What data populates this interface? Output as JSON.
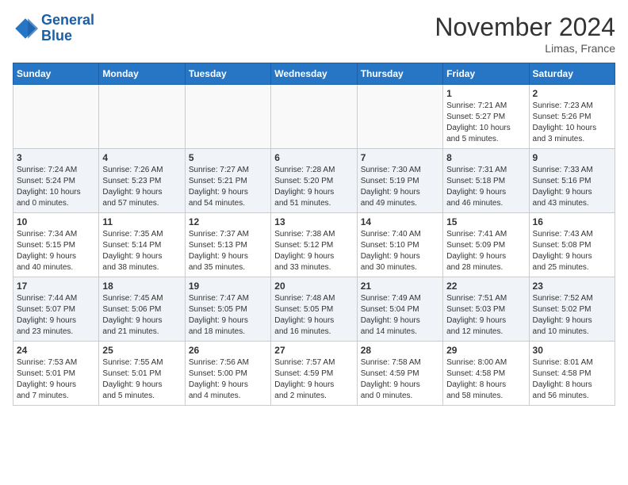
{
  "header": {
    "logo_line1": "General",
    "logo_line2": "Blue",
    "month_title": "November 2024",
    "location": "Limas, France"
  },
  "weekdays": [
    "Sunday",
    "Monday",
    "Tuesday",
    "Wednesday",
    "Thursday",
    "Friday",
    "Saturday"
  ],
  "weeks": [
    [
      {
        "day": "",
        "info": ""
      },
      {
        "day": "",
        "info": ""
      },
      {
        "day": "",
        "info": ""
      },
      {
        "day": "",
        "info": ""
      },
      {
        "day": "",
        "info": ""
      },
      {
        "day": "1",
        "info": "Sunrise: 7:21 AM\nSunset: 5:27 PM\nDaylight: 10 hours\nand 5 minutes."
      },
      {
        "day": "2",
        "info": "Sunrise: 7:23 AM\nSunset: 5:26 PM\nDaylight: 10 hours\nand 3 minutes."
      }
    ],
    [
      {
        "day": "3",
        "info": "Sunrise: 7:24 AM\nSunset: 5:24 PM\nDaylight: 10 hours\nand 0 minutes."
      },
      {
        "day": "4",
        "info": "Sunrise: 7:26 AM\nSunset: 5:23 PM\nDaylight: 9 hours\nand 57 minutes."
      },
      {
        "day": "5",
        "info": "Sunrise: 7:27 AM\nSunset: 5:21 PM\nDaylight: 9 hours\nand 54 minutes."
      },
      {
        "day": "6",
        "info": "Sunrise: 7:28 AM\nSunset: 5:20 PM\nDaylight: 9 hours\nand 51 minutes."
      },
      {
        "day": "7",
        "info": "Sunrise: 7:30 AM\nSunset: 5:19 PM\nDaylight: 9 hours\nand 49 minutes."
      },
      {
        "day": "8",
        "info": "Sunrise: 7:31 AM\nSunset: 5:18 PM\nDaylight: 9 hours\nand 46 minutes."
      },
      {
        "day": "9",
        "info": "Sunrise: 7:33 AM\nSunset: 5:16 PM\nDaylight: 9 hours\nand 43 minutes."
      }
    ],
    [
      {
        "day": "10",
        "info": "Sunrise: 7:34 AM\nSunset: 5:15 PM\nDaylight: 9 hours\nand 40 minutes."
      },
      {
        "day": "11",
        "info": "Sunrise: 7:35 AM\nSunset: 5:14 PM\nDaylight: 9 hours\nand 38 minutes."
      },
      {
        "day": "12",
        "info": "Sunrise: 7:37 AM\nSunset: 5:13 PM\nDaylight: 9 hours\nand 35 minutes."
      },
      {
        "day": "13",
        "info": "Sunrise: 7:38 AM\nSunset: 5:12 PM\nDaylight: 9 hours\nand 33 minutes."
      },
      {
        "day": "14",
        "info": "Sunrise: 7:40 AM\nSunset: 5:10 PM\nDaylight: 9 hours\nand 30 minutes."
      },
      {
        "day": "15",
        "info": "Sunrise: 7:41 AM\nSunset: 5:09 PM\nDaylight: 9 hours\nand 28 minutes."
      },
      {
        "day": "16",
        "info": "Sunrise: 7:43 AM\nSunset: 5:08 PM\nDaylight: 9 hours\nand 25 minutes."
      }
    ],
    [
      {
        "day": "17",
        "info": "Sunrise: 7:44 AM\nSunset: 5:07 PM\nDaylight: 9 hours\nand 23 minutes."
      },
      {
        "day": "18",
        "info": "Sunrise: 7:45 AM\nSunset: 5:06 PM\nDaylight: 9 hours\nand 21 minutes."
      },
      {
        "day": "19",
        "info": "Sunrise: 7:47 AM\nSunset: 5:05 PM\nDaylight: 9 hours\nand 18 minutes."
      },
      {
        "day": "20",
        "info": "Sunrise: 7:48 AM\nSunset: 5:05 PM\nDaylight: 9 hours\nand 16 minutes."
      },
      {
        "day": "21",
        "info": "Sunrise: 7:49 AM\nSunset: 5:04 PM\nDaylight: 9 hours\nand 14 minutes."
      },
      {
        "day": "22",
        "info": "Sunrise: 7:51 AM\nSunset: 5:03 PM\nDaylight: 9 hours\nand 12 minutes."
      },
      {
        "day": "23",
        "info": "Sunrise: 7:52 AM\nSunset: 5:02 PM\nDaylight: 9 hours\nand 10 minutes."
      }
    ],
    [
      {
        "day": "24",
        "info": "Sunrise: 7:53 AM\nSunset: 5:01 PM\nDaylight: 9 hours\nand 7 minutes."
      },
      {
        "day": "25",
        "info": "Sunrise: 7:55 AM\nSunset: 5:01 PM\nDaylight: 9 hours\nand 5 minutes."
      },
      {
        "day": "26",
        "info": "Sunrise: 7:56 AM\nSunset: 5:00 PM\nDaylight: 9 hours\nand 4 minutes."
      },
      {
        "day": "27",
        "info": "Sunrise: 7:57 AM\nSunset: 4:59 PM\nDaylight: 9 hours\nand 2 minutes."
      },
      {
        "day": "28",
        "info": "Sunrise: 7:58 AM\nSunset: 4:59 PM\nDaylight: 9 hours\nand 0 minutes."
      },
      {
        "day": "29",
        "info": "Sunrise: 8:00 AM\nSunset: 4:58 PM\nDaylight: 8 hours\nand 58 minutes."
      },
      {
        "day": "30",
        "info": "Sunrise: 8:01 AM\nSunset: 4:58 PM\nDaylight: 8 hours\nand 56 minutes."
      }
    ]
  ]
}
